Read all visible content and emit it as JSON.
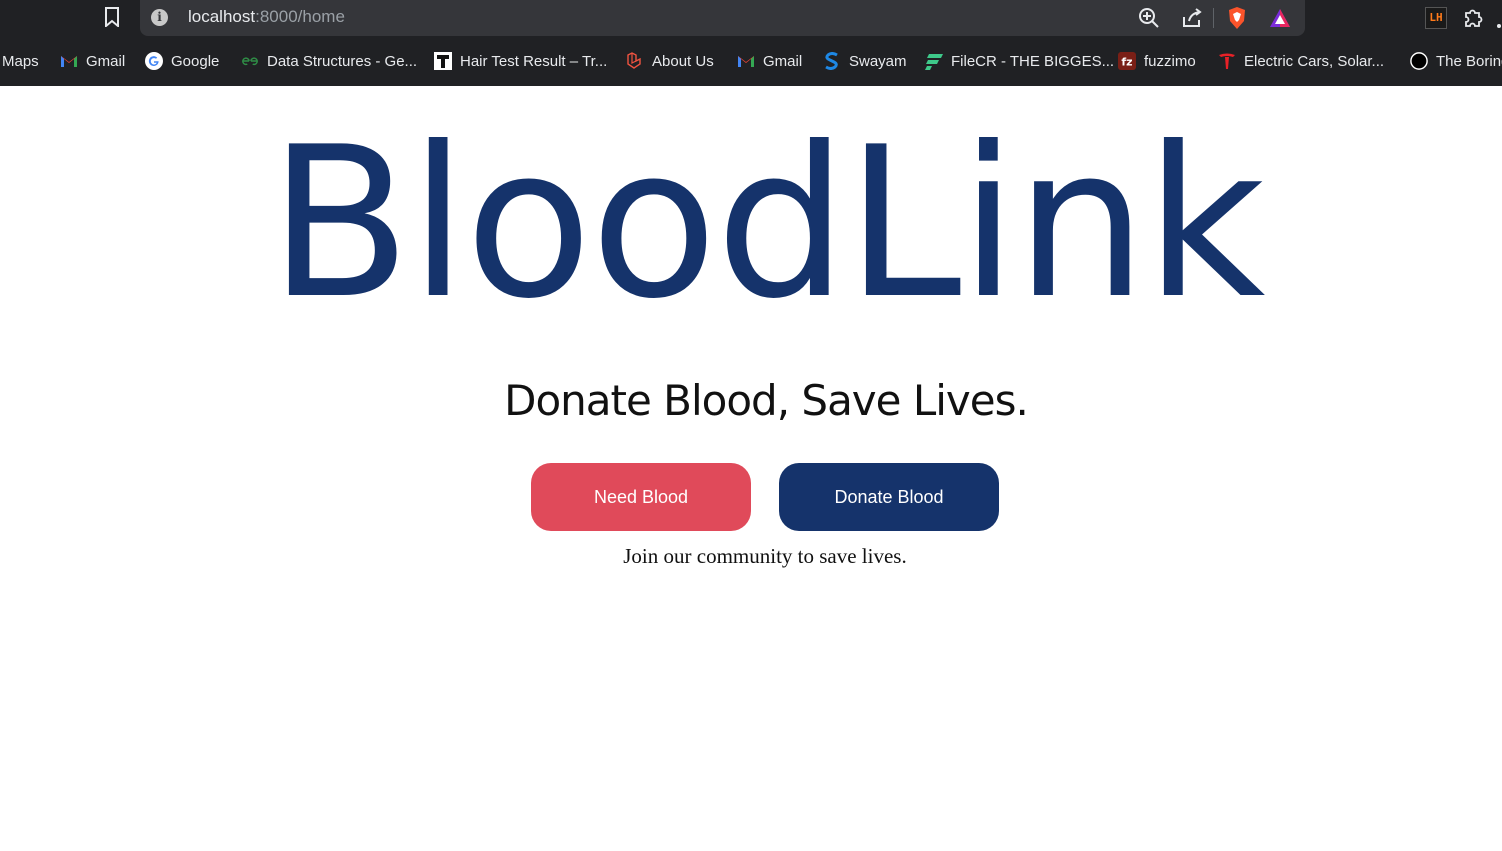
{
  "browser": {
    "url_host": "localhost",
    "url_path": ":8000/home",
    "bookmarks": [
      {
        "label": "Maps",
        "icon": "maps-icon"
      },
      {
        "label": "Gmail",
        "icon": "gmail-icon"
      },
      {
        "label": "Google",
        "icon": "google-icon"
      },
      {
        "label": "Data Structures - Ge...",
        "icon": "geeksforgeeks-icon"
      },
      {
        "label": "Hair Test Result – Tr...",
        "icon": "t-icon"
      },
      {
        "label": "About Us",
        "icon": "laravel-icon"
      },
      {
        "label": "Gmail",
        "icon": "gmail-icon"
      },
      {
        "label": "Swayam",
        "icon": "swayam-icon"
      },
      {
        "label": "FileCR - THE BIGGES...",
        "icon": "filecr-icon"
      },
      {
        "label": "fuzzimo",
        "icon": "fuzzimo-icon"
      },
      {
        "label": "Electric Cars, Solar...",
        "icon": "tesla-icon"
      },
      {
        "label": "The Boring",
        "icon": "boring-company-icon"
      }
    ],
    "extensions": {
      "lighthouse_label": "LH"
    }
  },
  "page": {
    "brand": "BloodLink",
    "tagline": "Donate Blood, Save Lives.",
    "buttons": {
      "need": "Need Blood",
      "donate": "Donate Blood"
    },
    "join_text": "Join our community to save lives."
  },
  "colors": {
    "brand_navy": "#15336b",
    "need_red": "#e04a5a",
    "chrome_dark": "#202124"
  }
}
